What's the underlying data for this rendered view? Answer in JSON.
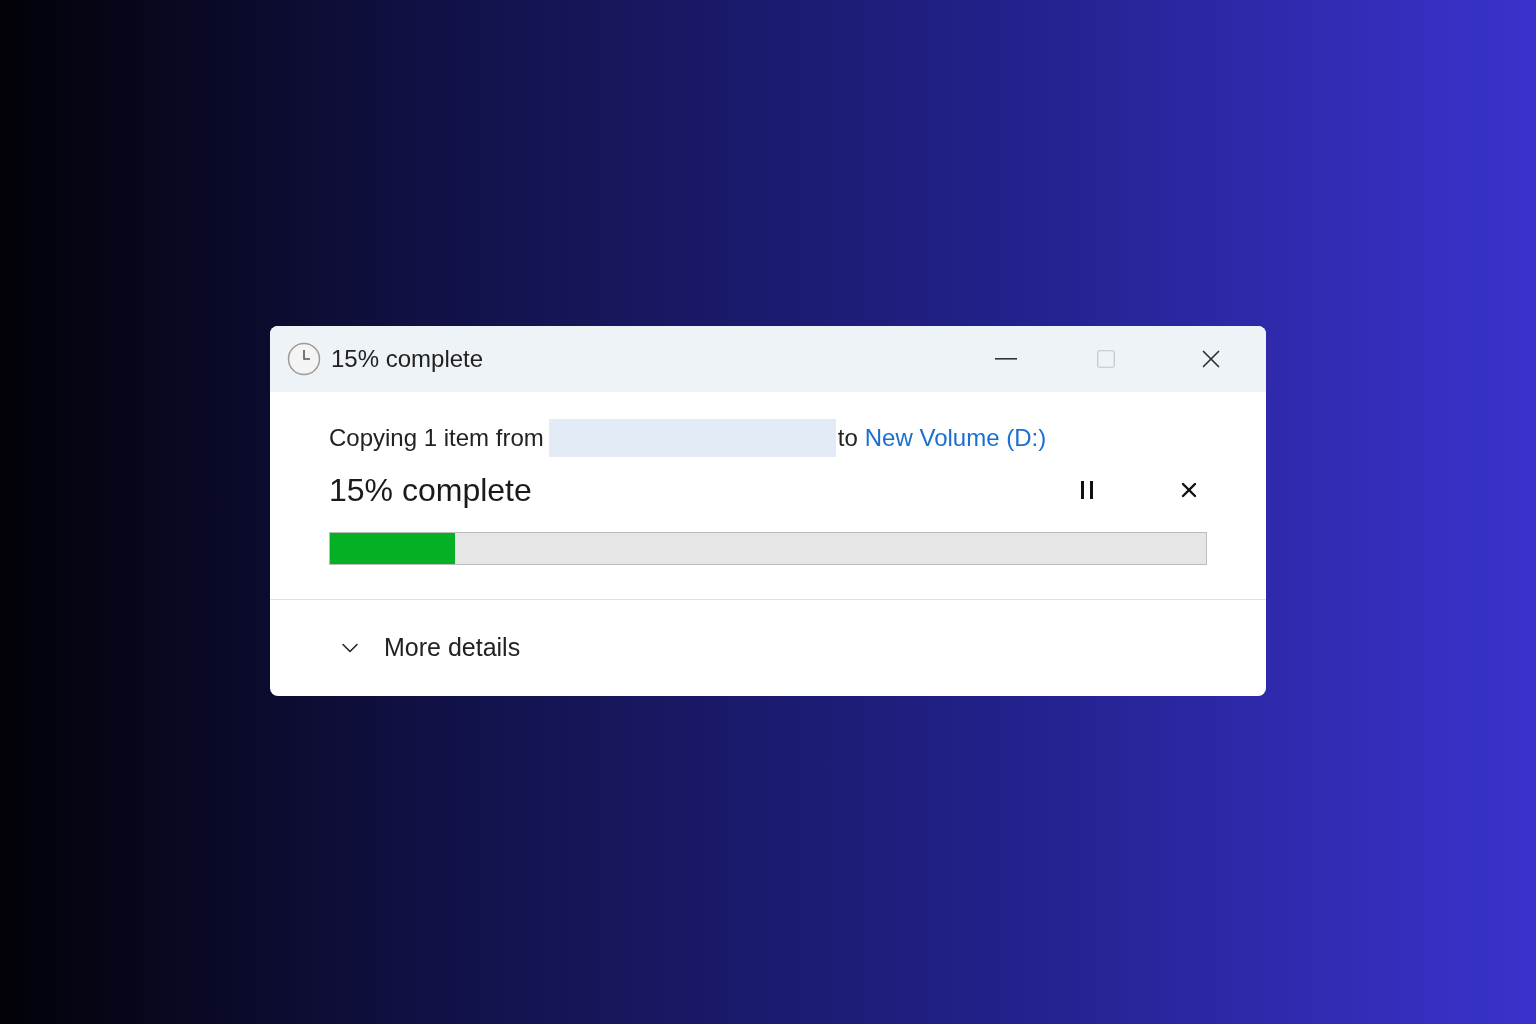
{
  "window": {
    "title": "15% complete"
  },
  "message": {
    "prefix": "Copying 1 item from",
    "destination_prefix": "to",
    "destination": "New Volume (D:)"
  },
  "status": "15% complete",
  "progress": {
    "level": 0.15
  },
  "details_toggle": {
    "label": "More details",
    "expanded": false
  }
}
